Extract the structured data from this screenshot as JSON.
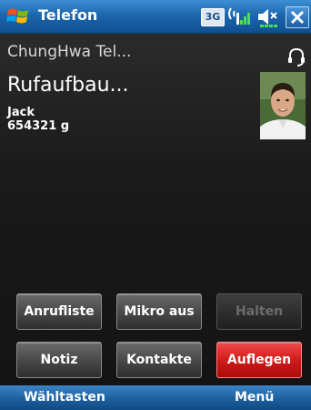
{
  "title_bar": {
    "title": "Telefon",
    "network_type": "3G",
    "icons": [
      "windows-start-icon",
      "signal-strength-icon",
      "volume-icon",
      "close-icon"
    ]
  },
  "call": {
    "operator": "ChungHwa Tel...",
    "status": "Rufaufbau...",
    "contact_name": "Jack",
    "contact_number": "654321 g"
  },
  "buttons": {
    "call_log": "Anrufliste",
    "mute": "Mikro aus",
    "hold": "Halten",
    "note": "Notiz",
    "contacts": "Kontakte",
    "end_call": "Auflegen"
  },
  "softkeys": {
    "left": "Wähltasten",
    "right": "Menü"
  },
  "colors": {
    "title_bar": "#1d67ad",
    "end_call": "#d21b1b",
    "background": "#1a1a1a"
  }
}
